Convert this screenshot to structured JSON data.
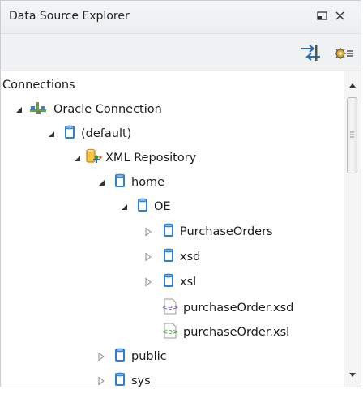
{
  "panel": {
    "title": "Data Source Explorer",
    "title_icons": [
      "minimize-icon",
      "close-icon"
    ]
  },
  "toolbar": {
    "buttons": [
      {
        "name": "connect-icon"
      },
      {
        "name": "settings-icon"
      }
    ]
  },
  "tree": {
    "root": "Connections",
    "nodes": [
      {
        "label": "Oracle Connection",
        "icon": "connection-icon",
        "expanded": true
      },
      {
        "label": "(default)",
        "icon": "database-icon",
        "expanded": true
      },
      {
        "label": "XML Repository",
        "icon": "xml-repository-icon",
        "expanded": true
      },
      {
        "label": "home",
        "icon": "database-icon",
        "expanded": true
      },
      {
        "label": "OE",
        "icon": "database-icon",
        "expanded": true
      },
      {
        "label": "PurchaseOrders",
        "icon": "database-icon",
        "expanded": false
      },
      {
        "label": "xsd",
        "icon": "database-icon",
        "expanded": false
      },
      {
        "label": "xsl",
        "icon": "database-icon",
        "expanded": false
      },
      {
        "label": "purchaseOrder.xsd",
        "icon": "xsd-file-icon"
      },
      {
        "label": "purchaseOrder.xsl",
        "icon": "xsl-file-icon"
      },
      {
        "label": "public",
        "icon": "database-icon",
        "expanded": false
      },
      {
        "label": "sys",
        "icon": "database-icon",
        "expanded": false
      }
    ]
  },
  "colors": {
    "database": "#2f7fd1",
    "repository": "#e0a020",
    "xsd": "#7a3fb3",
    "xsl": "#3c9a2d"
  }
}
